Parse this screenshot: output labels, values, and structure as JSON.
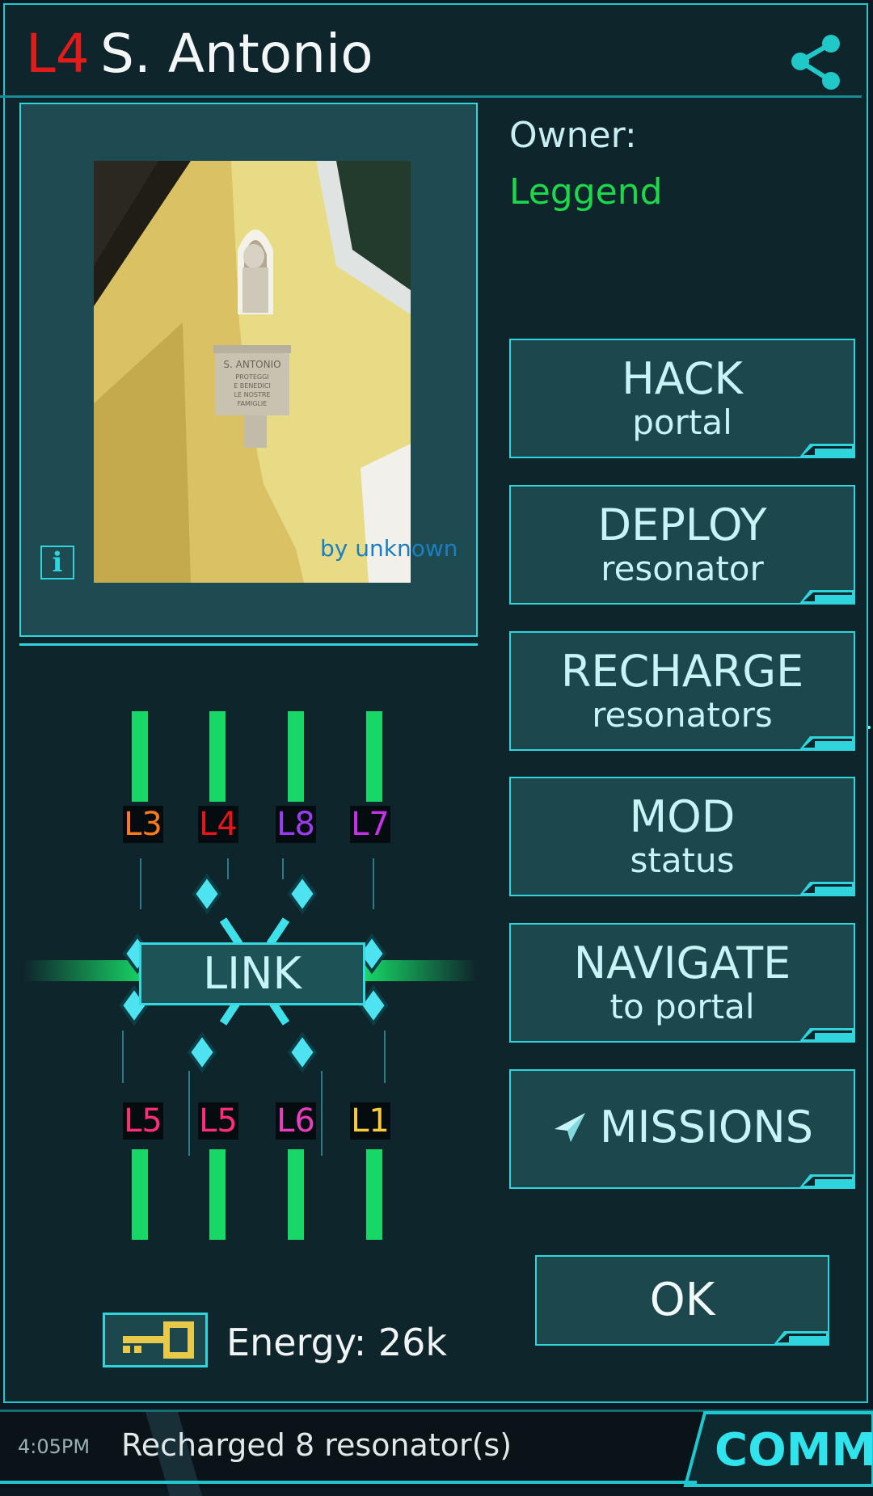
{
  "header": {
    "level": "L4",
    "portal_name": "S. Antonio",
    "share_icon": "share-icon"
  },
  "photo": {
    "credit": "by unknown",
    "info_icon": "info-icon",
    "info_label": "i"
  },
  "owner": {
    "label": "Owner:",
    "name": "Leggend"
  },
  "actions": [
    {
      "main": "HACK",
      "sub": "portal"
    },
    {
      "main": "DEPLOY",
      "sub": "resonator"
    },
    {
      "main": "RECHARGE",
      "sub": "resonators"
    },
    {
      "main": "MOD",
      "sub": "status"
    },
    {
      "main": "NAVIGATE",
      "sub": "to portal"
    },
    {
      "main": "MISSIONS",
      "sub": ""
    }
  ],
  "ok_label": "OK",
  "resonators": {
    "top": [
      {
        "level": "L3",
        "color": "#ff7a1a",
        "energy": 1.0
      },
      {
        "level": "L4",
        "color": "#e8151b",
        "energy": 1.0
      },
      {
        "level": "L8",
        "color": "#9b3cf0",
        "energy": 1.0
      },
      {
        "level": "L7",
        "color": "#c732e8",
        "energy": 1.0
      }
    ],
    "bottom": [
      {
        "level": "L5",
        "color": "#ff2d7a",
        "energy": 1.0
      },
      {
        "level": "L5",
        "color": "#ff2d7a",
        "energy": 1.0
      },
      {
        "level": "L6",
        "color": "#e83ec0",
        "energy": 1.0
      },
      {
        "level": "L1",
        "color": "#f7cc3c",
        "energy": 1.0
      }
    ],
    "link_label": "LINK"
  },
  "energy": {
    "label": "Energy: 26k",
    "key_icon": "key-icon"
  },
  "status_bar": {
    "time": "4:05PM",
    "message": "Recharged 8 resonator(s)",
    "comm_label": "COMM"
  },
  "colors": {
    "accent": "#2fd4dc",
    "owner": "#1ed84b",
    "level": "#e21b1b",
    "resonator_bar": "#17d866"
  }
}
